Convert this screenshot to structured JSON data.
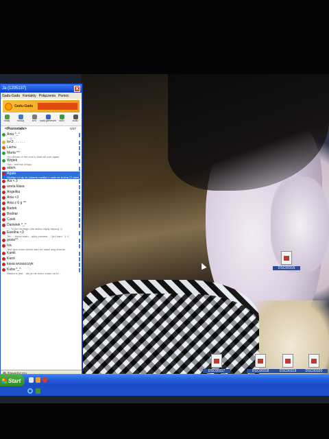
{
  "gg_window": {
    "title": "Ja (1205137)",
    "close_label": "x",
    "menu": [
      "Gadu-Gadu",
      "Kontakty",
      "Połączenia",
      "Pomoc"
    ],
    "banner_text": "Gadu-Gadu",
    "toolbar": [
      "dodaj",
      "szukaj",
      "sms",
      "wyśij gameweb",
      "radio",
      "audio"
    ],
    "group": "<Pozostałe>",
    "counter": "5/37",
    "contacts": [
      {
        "name": "Ania ^_^",
        "desc": "~~()~~",
        "status": "on"
      },
      {
        "name": "la<3 . . . . . .",
        "desc": "",
        "status": "busy"
      },
      {
        "name": "Lachu",
        "desc": "",
        "status": "away"
      },
      {
        "name": "Marta ^^",
        "desc": "You dream of the end to start all over again",
        "status": "on"
      },
      {
        "name": "Wojtek",
        "desc": "Opo. Jest Na Urlopo",
        "status": "on"
      },
      {
        "name": "adam",
        "desc": "",
        "status": "off"
      },
      {
        "name": "Agata",
        "desc": "Wydaje mi się że czasem myślisz o mnie że trochę CI zależy? =]]] KxD :)**",
        "status": "off",
        "selected": true
      },
      {
        "name": "Ala < 3",
        "desc": "",
        "status": "off"
      },
      {
        "name": "aneta klasa",
        "desc": "",
        "status": "off"
      },
      {
        "name": "Angelika",
        "desc": "",
        "status": "off"
      },
      {
        "name": "Ania <3",
        "desc": "",
        "status": "off"
      },
      {
        "name": "Ania z 6 g ^^",
        "desc": "",
        "status": "off"
      },
      {
        "name": "Bartek",
        "desc": "",
        "status": "off"
      },
      {
        "name": "Bednar",
        "desc": "",
        "status": "off"
      },
      {
        "name": "Cziek",
        "desc": "",
        "status": "off"
      },
      {
        "name": "Danielek ^_^",
        "desc": "~~ To już niedługo (nie wolno nigdy więcej) =)",
        "status": "off"
      },
      {
        "name": "Ewelina <3",
        "desc": "Ten ... dzida mam... tylko powiem... I (to) ham ' :) ^)",
        "status": "off"
      },
      {
        "name": "gosia^^",
        "desc": "",
        "status": "off"
      },
      {
        "name": "Iza",
        "desc": "Jest ginn mam chemi start ref nadzi ang mazole",
        "status": "off"
      },
      {
        "name": "Kamil",
        "desc": "",
        "status": "off"
      },
      {
        "name": "Karol",
        "desc": "",
        "status": "off"
      },
      {
        "name": "kasia wrzaszczyk",
        "desc": "",
        "status": "off"
      },
      {
        "name": "Kuba ^_^",
        "desc": "Nauka to jest... ale ja nie mam czasu na to...",
        "status": "off"
      }
    ],
    "status_label": "Niewidoczny"
  },
  "desktop_icons": [
    "DSC00316",
    "DSC00317",
    "DSC00318",
    "DSC00319",
    "DSC00320"
  ],
  "taskbar": {
    "start_label": "Start"
  }
}
